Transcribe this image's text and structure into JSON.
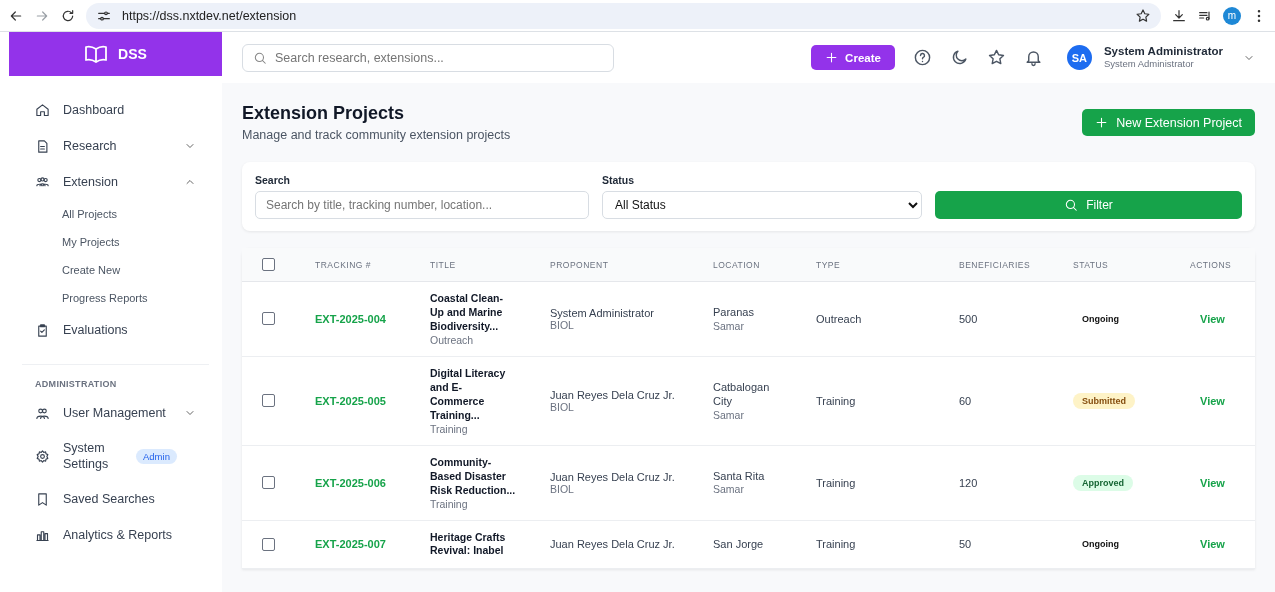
{
  "browser": {
    "url": "https://dss.nxtdev.net/extension",
    "profile": "m"
  },
  "sidebar": {
    "logo": "DSS",
    "items": [
      {
        "label": "Dashboard"
      },
      {
        "label": "Research",
        "expanded": false
      },
      {
        "label": "Extension",
        "expanded": true,
        "children": [
          {
            "label": "All Projects"
          },
          {
            "label": "My Projects"
          },
          {
            "label": "Create New"
          },
          {
            "label": "Progress Reports"
          }
        ]
      },
      {
        "label": "Evaluations"
      }
    ],
    "section": "ADMINISTRATION",
    "admin_items": [
      {
        "label": "User Management",
        "expanded": false
      },
      {
        "label": "System Settings",
        "badge": "Admin"
      },
      {
        "label": "Saved Searches"
      },
      {
        "label": "Analytics & Reports"
      }
    ]
  },
  "header": {
    "search_placeholder": "Search research, extensions...",
    "create_button": "Create",
    "avatar": "SA",
    "user_name": "System Administrator",
    "user_role": "System Administrator"
  },
  "page": {
    "title": "Extension Projects",
    "subtitle": "Manage and track community extension projects",
    "new_button": "New Extension Project"
  },
  "filters": {
    "search_label": "Search",
    "search_placeholder": "Search by title, tracking number, location...",
    "status_label": "Status",
    "status_value": "All Status",
    "filter_button": "Filter"
  },
  "table": {
    "header_checked": false,
    "columns": [
      "TRACKING #",
      "TITLE",
      "PROPONENT",
      "LOCATION",
      "TYPE",
      "BENEFICIARIES",
      "STATUS",
      "ACTIONS"
    ],
    "rows": [
      {
        "checked": false,
        "tracking": "EXT-2025-004",
        "title": "Coastal Clean-Up and Marine Biodiversity...",
        "category": "Outreach",
        "proponent": "System Administrator",
        "department": "BIOL",
        "location": "Paranas",
        "region": "Samar",
        "type": "Outreach",
        "beneficiaries": "500",
        "status": {
          "label": "Ongoing",
          "kind": "ongoing"
        },
        "action": "View"
      },
      {
        "checked": false,
        "tracking": "EXT-2025-005",
        "title": "Digital Literacy and E-Commerce Training...",
        "category": "Training",
        "proponent": "Juan Reyes Dela Cruz Jr.",
        "department": "BIOL",
        "location": "Catbalogan City",
        "region": "Samar",
        "type": "Training",
        "beneficiaries": "60",
        "status": {
          "label": "Submitted",
          "kind": "submitted"
        },
        "action": "View"
      },
      {
        "checked": false,
        "tracking": "EXT-2025-006",
        "title": "Community-Based Disaster Risk Reduction...",
        "category": "Training",
        "proponent": "Juan Reyes Dela Cruz Jr.",
        "department": "BIOL",
        "location": "Santa Rita",
        "region": "Samar",
        "type": "Training",
        "beneficiaries": "120",
        "status": {
          "label": "Approved",
          "kind": "approved"
        },
        "action": "View"
      },
      {
        "checked": false,
        "tracking": "EXT-2025-007",
        "title": "Heritage Crafts Revival: Inabel",
        "proponent": "Juan Reyes Dela Cruz Jr.",
        "location": "San Jorge",
        "type": "Training",
        "beneficiaries": "50",
        "status": {
          "label": "Ongoing",
          "kind": "ongoing"
        },
        "action": "View"
      }
    ]
  }
}
